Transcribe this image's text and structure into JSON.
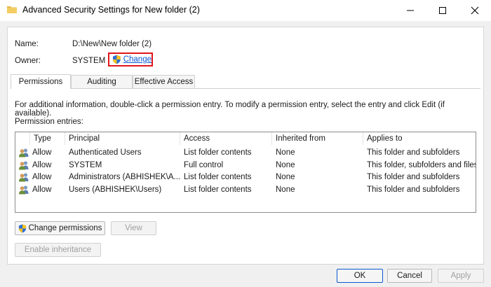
{
  "window": {
    "title": "Advanced Security Settings for New folder (2)"
  },
  "info": {
    "name_label": "Name:",
    "name_value": "D:\\New\\New folder (2)",
    "owner_label": "Owner:",
    "owner_value": "SYSTEM",
    "change_link": "Change"
  },
  "tabs": [
    {
      "label": "Permissions",
      "active": true
    },
    {
      "label": "Auditing",
      "active": false
    },
    {
      "label": "Effective Access",
      "active": false
    }
  ],
  "description": "For additional information, double-click a permission entry. To modify a permission entry, select the entry and click Edit (if available).",
  "entries_label": "Permission entries:",
  "table": {
    "headers": {
      "type": "Type",
      "principal": "Principal",
      "access": "Access",
      "inherited": "Inherited from",
      "applies": "Applies to"
    },
    "rows": [
      {
        "type": "Allow",
        "principal": "Authenticated Users",
        "access": "List folder contents",
        "inherited": "None",
        "applies": "This folder and subfolders"
      },
      {
        "type": "Allow",
        "principal": "SYSTEM",
        "access": "Full control",
        "inherited": "None",
        "applies": "This folder, subfolders and files"
      },
      {
        "type": "Allow",
        "principal": "Administrators (ABHISHEK\\A...",
        "access": "List folder contents",
        "inherited": "None",
        "applies": "This folder and subfolders"
      },
      {
        "type": "Allow",
        "principal": "Users (ABHISHEK\\Users)",
        "access": "List folder contents",
        "inherited": "None",
        "applies": "This folder and subfolders"
      }
    ]
  },
  "buttons": {
    "change_permissions": "Change permissions",
    "view": "View",
    "enable_inheritance": "Enable inheritance",
    "ok": "OK",
    "cancel": "Cancel",
    "apply": "Apply"
  },
  "colors": {
    "highlight_border": "#e0161b",
    "link": "#0b57d0",
    "shield_blue": "#2f6fd6",
    "shield_yellow": "#f5c21b"
  },
  "icons": {
    "title": "security-folder-icon",
    "shield": "uac-shield-icon",
    "principal": "users-group-icon"
  }
}
